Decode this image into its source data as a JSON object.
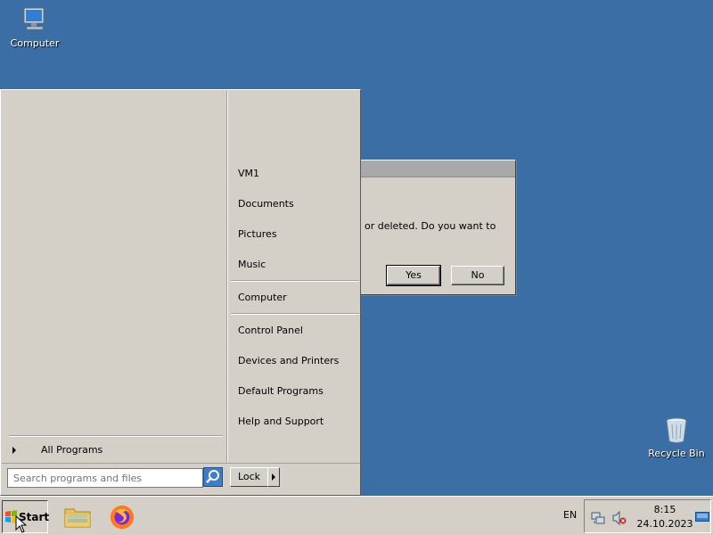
{
  "desktop": {
    "icons": [
      {
        "label": "Computer",
        "icon": "computer-icon"
      },
      {
        "label": "Recycle Bin",
        "icon": "recycle-bin-icon"
      }
    ]
  },
  "dialog": {
    "message": "or deleted. Do you want to",
    "yes_label": "Yes",
    "no_label": "No"
  },
  "start_menu": {
    "all_programs_label": "All Programs",
    "right_items": [
      "VM1",
      "Documents",
      "Pictures",
      "Music",
      "Computer",
      "Control Panel",
      "Devices and Printers",
      "Default Programs",
      "Help and Support"
    ],
    "search_placeholder": "Search programs and files",
    "lock_label": "Lock"
  },
  "taskbar": {
    "start_label": "Start",
    "apps": [
      {
        "icon": "file-explorer-icon"
      },
      {
        "icon": "firefox-icon"
      }
    ],
    "language": "EN",
    "time": "8:15",
    "date": "24.10.2023"
  },
  "colors": {
    "desktop_bg": "#3a6ea5",
    "chrome": "#d4d0c8"
  }
}
